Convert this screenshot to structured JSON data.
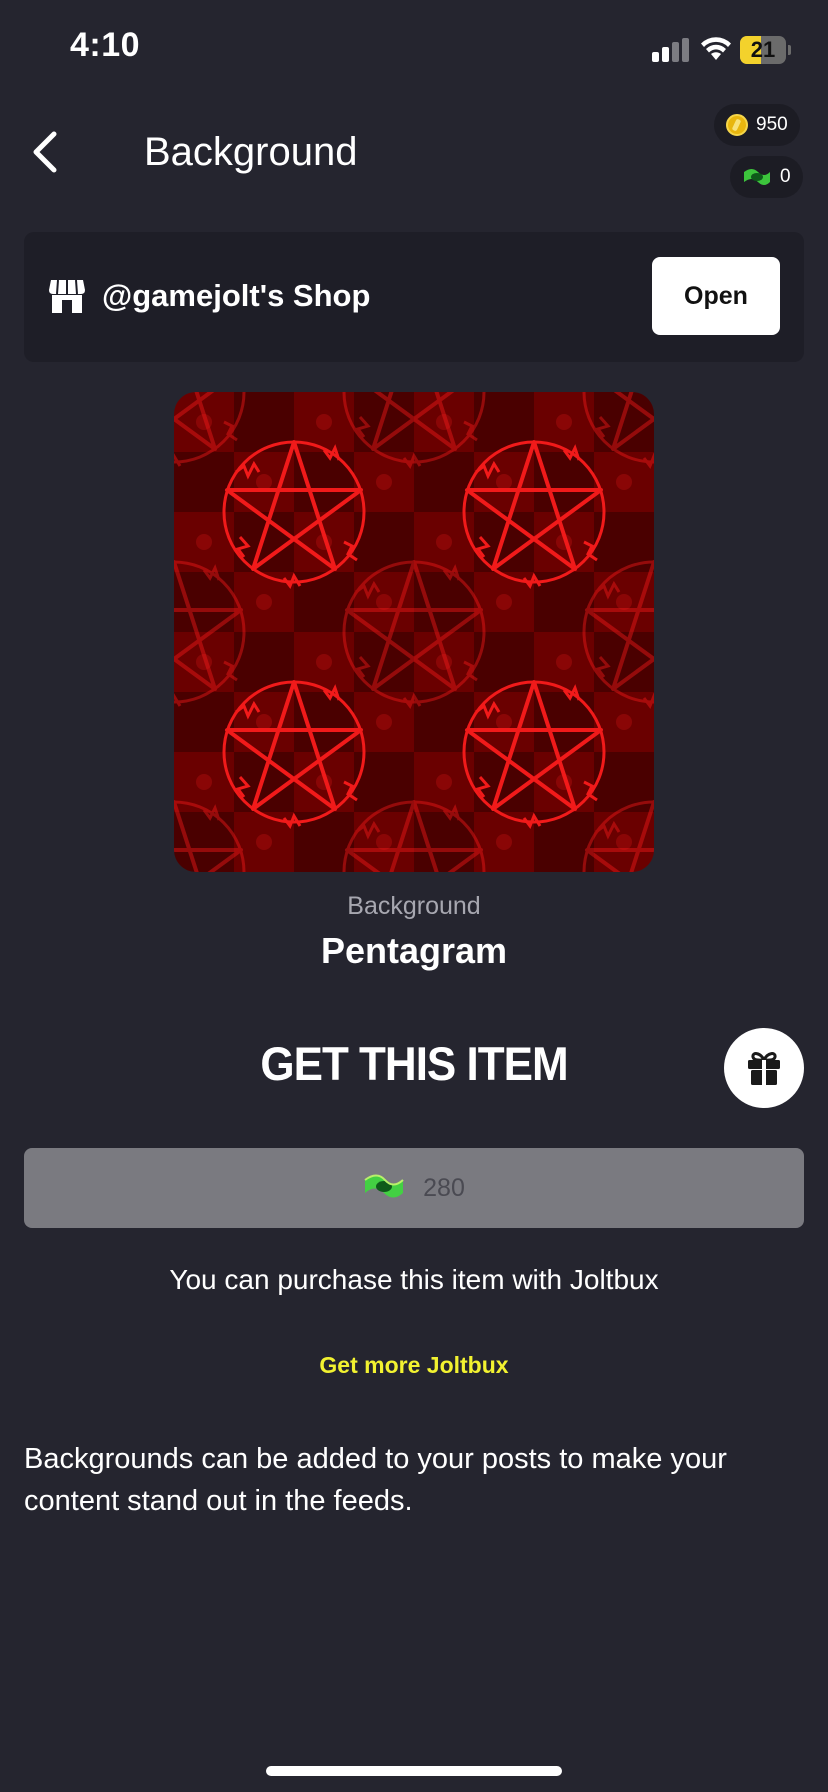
{
  "status": {
    "time": "4:10",
    "battery": "21"
  },
  "header": {
    "title": "Background",
    "coins": "950",
    "joltbux": "0"
  },
  "shop": {
    "name": "@gamejolt's Shop",
    "open_label": "Open"
  },
  "item": {
    "type": "Background",
    "name": "Pentagram"
  },
  "purchase": {
    "title": "GET THIS ITEM",
    "price": "280",
    "note": "You can purchase this item with Joltbux",
    "get_more": "Get more Joltbux"
  },
  "description": "Backgrounds can be added to your posts to make your content stand out in the feeds.",
  "colors": {
    "background": "#25252f",
    "card": "#1e1e27",
    "accent_yellow": "#f2f230",
    "preview_red": "#e01010"
  }
}
